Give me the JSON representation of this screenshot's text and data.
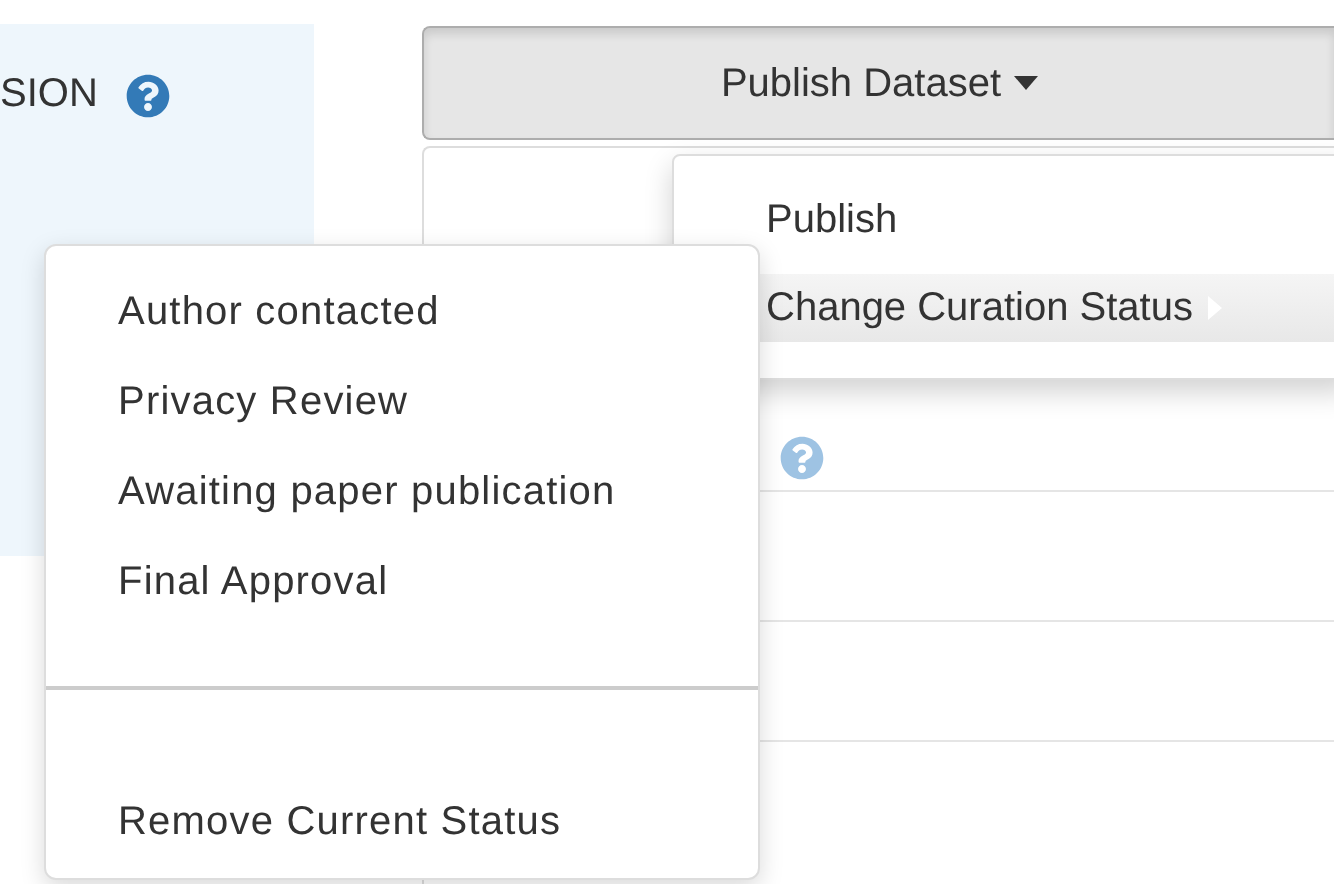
{
  "sidebar": {
    "heading": "SION"
  },
  "publish_button": {
    "label": "Publish Dataset"
  },
  "menu": {
    "items": [
      {
        "label": "Publish",
        "selected": false,
        "has_submenu": false
      },
      {
        "label": "Change Curation Status",
        "selected": true,
        "has_submenu": true
      }
    ]
  },
  "submenu": {
    "items": [
      "Author contacted",
      "Privacy Review",
      "Awaiting paper publication",
      "Final Approval"
    ],
    "footer_item": "Remove Current Status"
  }
}
